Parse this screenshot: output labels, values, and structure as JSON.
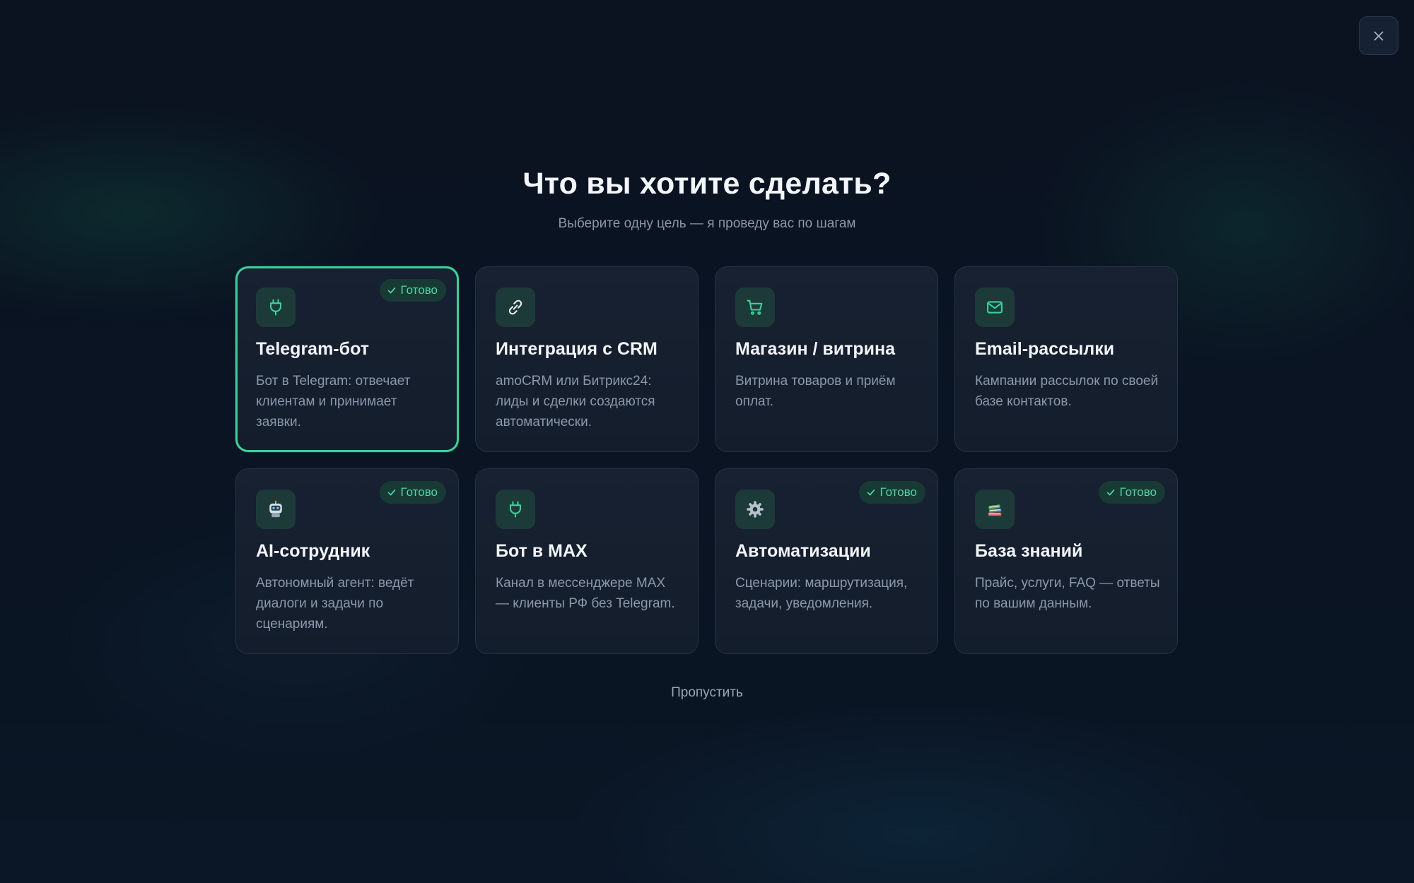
{
  "dialog": {
    "title": "Что вы хотите сделать?",
    "subtitle": "Выберите одну цель — я проведу вас по шагам",
    "skip_label": "Пропустить"
  },
  "colors": {
    "accent": "#3ad19a",
    "badge_text": "#4fd6a2",
    "background": "#0b1220",
    "card": "#172131"
  },
  "cards": [
    {
      "title": "Telegram-бот",
      "description": "Бот в Telegram: отвечает клиентам и принимает заявки.",
      "icon": "plug-icon",
      "badge": "Готово",
      "selected": true
    },
    {
      "title": "Интеграция с CRM",
      "description": "amoCRM или Битрикс24: лиды и сделки создаются автоматически.",
      "icon": "link-icon",
      "badge": null,
      "selected": false
    },
    {
      "title": "Магазин / витрина",
      "description": "Витрина товаров и приём оплат.",
      "icon": "cart-icon",
      "badge": null,
      "selected": false
    },
    {
      "title": "Email-рассылки",
      "description": "Кампании рассылок по своей базе контактов.",
      "icon": "mail-icon",
      "badge": null,
      "selected": false
    },
    {
      "title": "AI-сотрудник",
      "description": "Автономный агент: ведёт диалоги и задачи по сценариям.",
      "icon": "robot-icon",
      "badge": "Готово",
      "selected": false
    },
    {
      "title": "Бот в MAX",
      "description": "Канал в мессенджере MAX — клиенты РФ без Telegram.",
      "icon": "plug-icon",
      "badge": null,
      "selected": false
    },
    {
      "title": "Автоматизации",
      "description": "Сценарии: маршрутизация, задачи, уведомления.",
      "icon": "gear-icon",
      "badge": "Готово",
      "selected": false
    },
    {
      "title": "База знаний",
      "description": "Прайс, услуги, FAQ — ответы по вашим данным.",
      "icon": "books-icon",
      "badge": "Готово",
      "selected": false
    }
  ]
}
